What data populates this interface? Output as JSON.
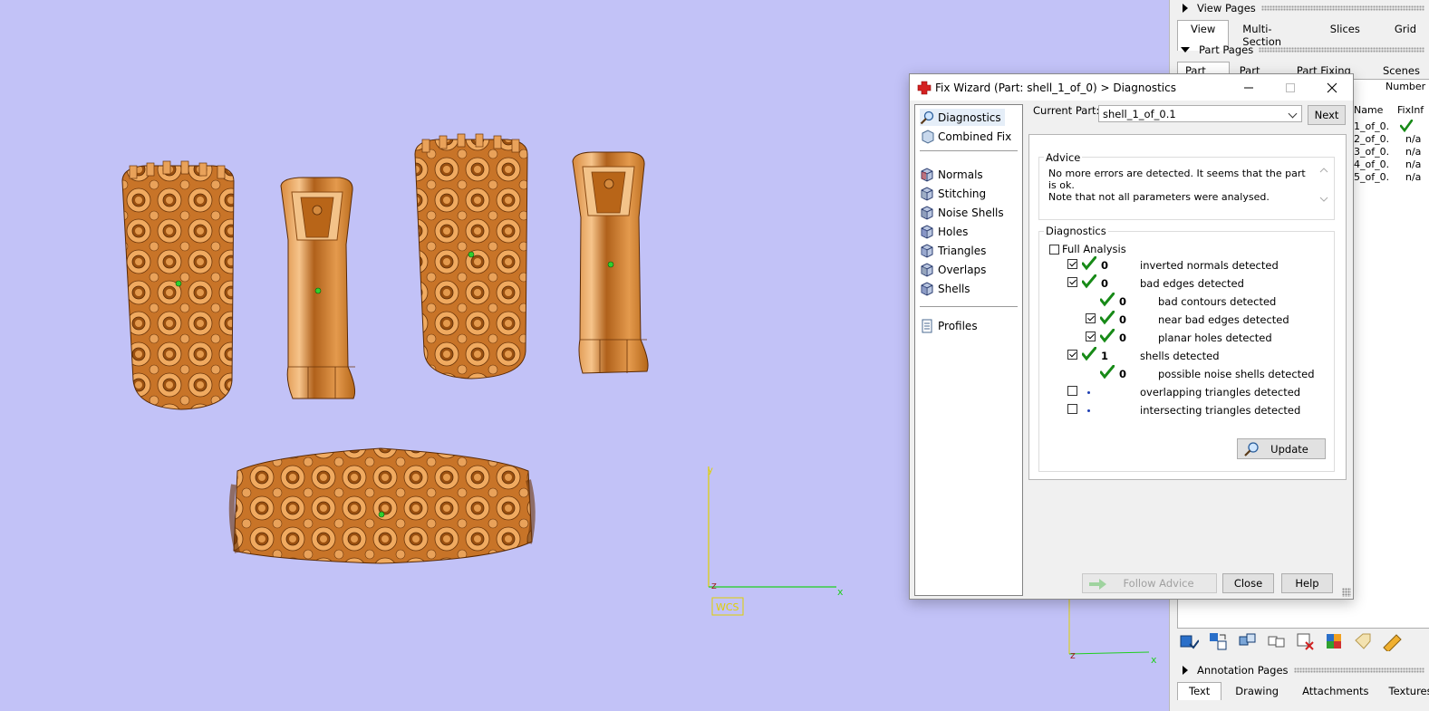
{
  "viewport": {
    "wcs_label": "WCS",
    "axis_labels": {
      "x": "x",
      "y": "y",
      "z": "z",
      "x2": "x",
      "z2": "z"
    },
    "colors": {
      "background": "#c2c2f7",
      "metal": "#c8782c",
      "axis_x": "#1fcf1f",
      "axis_y": "#e0d000"
    }
  },
  "right_panel": {
    "view_pages": {
      "title": "View Pages",
      "tabs": [
        "View",
        "Multi-Section",
        "Slices",
        "Grid"
      ],
      "active": "View"
    },
    "part_pages": {
      "title": "Part Pages",
      "tabs": [
        "Part List",
        "Part Info",
        "Part Fixing Info",
        "Scenes"
      ],
      "active": "Part List"
    },
    "part_list": {
      "col_number": "Number",
      "col_name": "Name",
      "col_fixinfo": "FixInf",
      "rows": [
        {
          "name": "1_of_0.",
          "fix": "check"
        },
        {
          "name": "2_of_0.",
          "fix": "n/a"
        },
        {
          "name": "3_of_0.",
          "fix": "n/a"
        },
        {
          "name": "4_of_0.",
          "fix": "n/a"
        },
        {
          "name": "5_of_0.",
          "fix": "n/a"
        }
      ]
    },
    "toolbar_icons": [
      "select-parts-icon",
      "swap-selection-icon",
      "cube-split-icon",
      "cube-merge-icon",
      "delete-part-icon",
      "color-part-icon",
      "tag-icon",
      "ruler-icon"
    ],
    "annotation_pages": {
      "title": "Annotation Pages",
      "tabs": [
        "Text",
        "Drawing",
        "Attachments",
        "Textures"
      ],
      "active": "Text"
    }
  },
  "dialog": {
    "title": "Fix Wizard (Part: shell_1_of_0) > Diagnostics",
    "nav": {
      "top": [
        "Diagnostics",
        "Combined Fix"
      ],
      "middle": [
        "Normals",
        "Stitching",
        "Noise Shells",
        "Holes",
        "Triangles",
        "Overlaps",
        "Shells"
      ],
      "bottom": [
        "Profiles"
      ],
      "selected": "Diagnostics"
    },
    "current_part_label": "Current Part:",
    "current_part_value": "shell_1_of_0.1",
    "next_label": "Next",
    "advice_title": "Advice",
    "advice_line1": "No more errors are detected. It seems that the part is ok.",
    "advice_line2": "Note that not all parameters were analysed.",
    "diagnostics_title": "Diagnostics",
    "full_analysis_label": "Full Analysis",
    "full_analysis_checked": false,
    "rows": [
      {
        "checkbox": true,
        "checked": true,
        "status": "ok",
        "count": "0",
        "text": "inverted normals detected",
        "indent": 0
      },
      {
        "checkbox": true,
        "checked": true,
        "status": "ok",
        "count": "0",
        "text": "bad edges detected",
        "indent": 0
      },
      {
        "checkbox": false,
        "checked": false,
        "status": "ok",
        "count": "0",
        "text": "bad contours detected",
        "indent": 1
      },
      {
        "checkbox": true,
        "checked": true,
        "status": "ok",
        "count": "0",
        "text": "near bad edges detected",
        "indent": 1
      },
      {
        "checkbox": true,
        "checked": true,
        "status": "ok",
        "count": "0",
        "text": "planar holes detected",
        "indent": 1
      },
      {
        "checkbox": true,
        "checked": true,
        "status": "ok",
        "count": "1",
        "text": "shells detected",
        "indent": 0
      },
      {
        "checkbox": false,
        "checked": false,
        "status": "ok",
        "count": "0",
        "text": "possible noise shells detected",
        "indent": 1
      },
      {
        "checkbox": true,
        "checked": false,
        "status": "dot",
        "count": "",
        "text": "overlapping triangles detected",
        "indent": 0
      },
      {
        "checkbox": true,
        "checked": false,
        "status": "dot",
        "count": "",
        "text": "intersecting triangles detected",
        "indent": 0
      }
    ],
    "update_label": "Update",
    "follow_advice_label": "Follow Advice",
    "close_label": "Close",
    "help_label": "Help"
  }
}
